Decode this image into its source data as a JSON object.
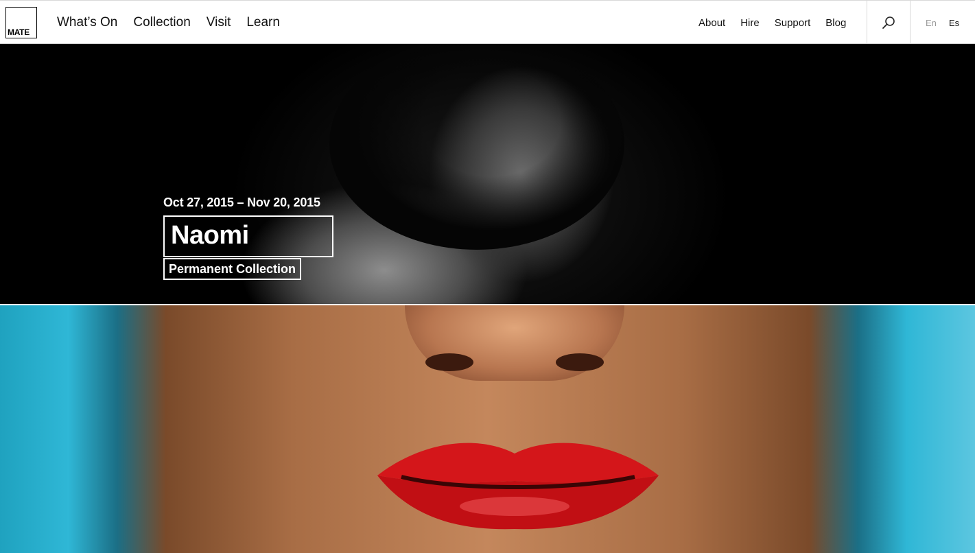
{
  "header": {
    "logo_text": "MATE",
    "main_nav": [
      "What’s On",
      "Collection",
      "Visit",
      "Learn"
    ],
    "secondary_nav": [
      "About",
      "Hire",
      "Support",
      "Blog"
    ],
    "languages": [
      {
        "label": "En",
        "color": "#999999"
      },
      {
        "label": "Es",
        "color": "#111111"
      }
    ]
  },
  "hero": {
    "date": "Oct 27, 2015 – Nov 20, 2015",
    "title": "Naomi",
    "tag": "Permanent Collection"
  },
  "colors": {
    "accent_cyan": "#2fb7d6",
    "lip_red": "#d4161a"
  }
}
